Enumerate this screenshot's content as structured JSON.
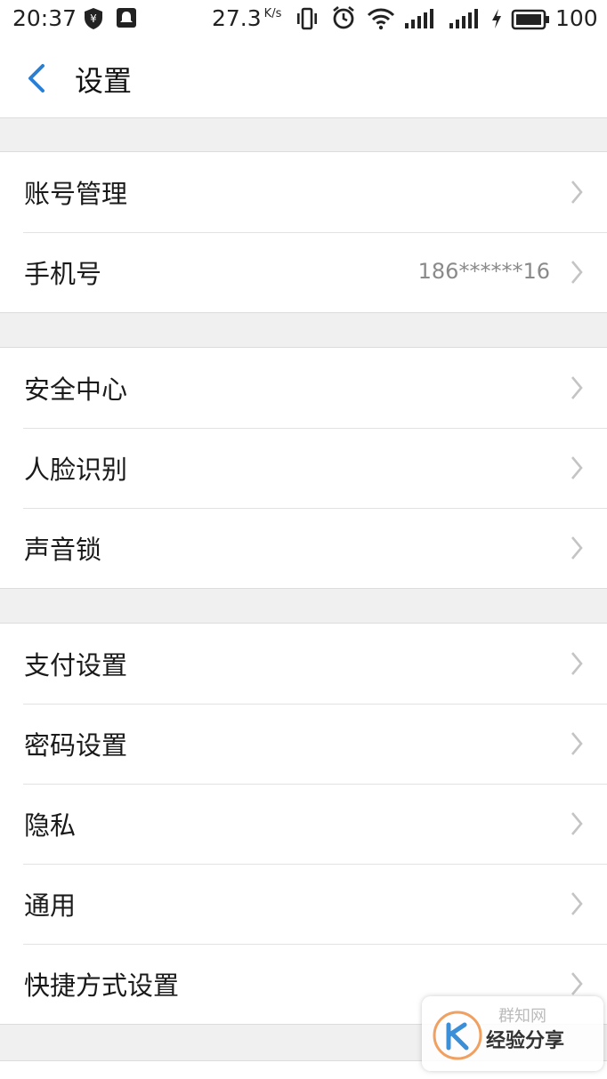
{
  "status_bar": {
    "time": "20:37",
    "speed": "27.3",
    "speed_unit": "K/s",
    "battery": "100"
  },
  "header": {
    "title": "设置"
  },
  "groups": [
    {
      "items": [
        {
          "label": "账号管理",
          "value": ""
        },
        {
          "label": "手机号",
          "value": "186******16"
        }
      ]
    },
    {
      "items": [
        {
          "label": "安全中心",
          "value": ""
        },
        {
          "label": "人脸识别",
          "value": ""
        },
        {
          "label": "声音锁",
          "value": ""
        }
      ]
    },
    {
      "items": [
        {
          "label": "支付设置",
          "value": ""
        },
        {
          "label": "密码设置",
          "value": ""
        },
        {
          "label": "隐私",
          "value": ""
        },
        {
          "label": "通用",
          "value": ""
        },
        {
          "label": "快捷方式设置",
          "value": ""
        }
      ]
    }
  ],
  "watermark": {
    "site": "群知网",
    "text": "经验分享"
  },
  "colors": {
    "accent": "#2a7fd4",
    "background": "#f0f0f0",
    "chevron": "#c4c4c4",
    "value_text": "#8a8a8a"
  }
}
